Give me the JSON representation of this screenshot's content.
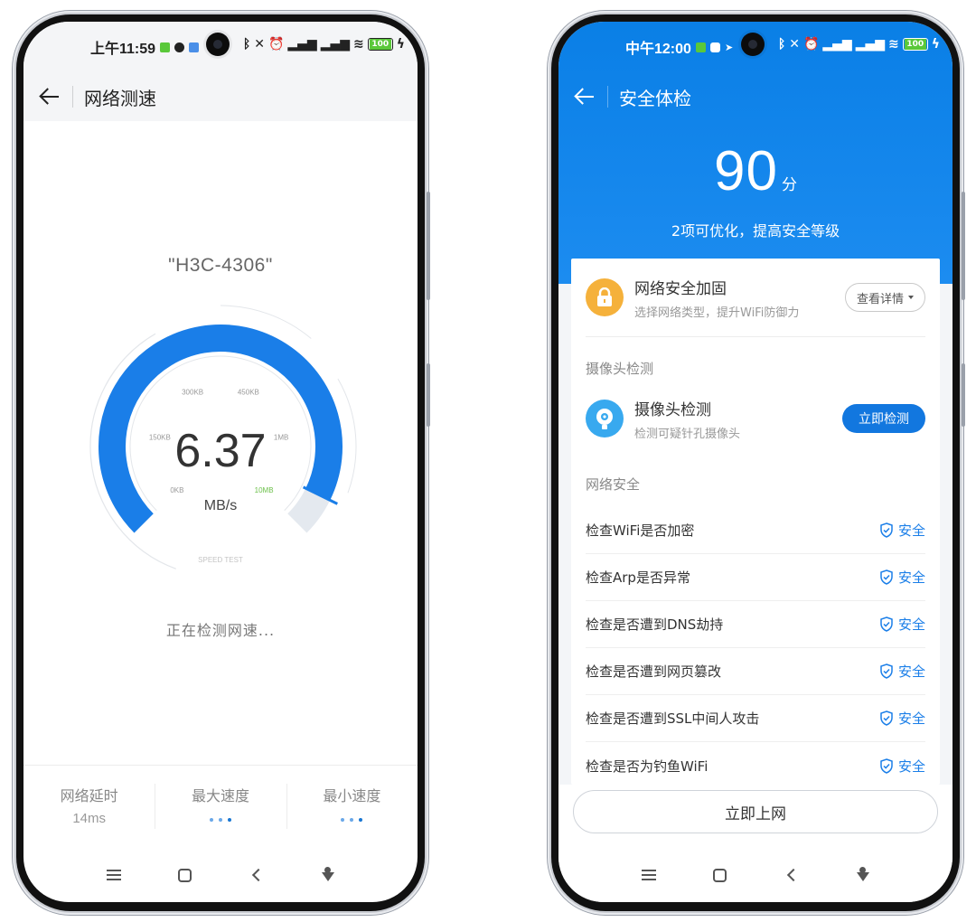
{
  "left_phone": {
    "status_bar": {
      "time": "上午11:59",
      "battery": "100"
    },
    "header": {
      "title": "网络测速"
    },
    "ssid": "\"H3C-4306\"",
    "gauge": {
      "speed_value": "6.37",
      "speed_unit": "MB/s",
      "tick_labels": [
        "0KB",
        "150KB",
        "300KB",
        "450KB",
        "1MB",
        "10MB"
      ],
      "caption": "SPEED TEST",
      "progress_fraction": 0.93,
      "colors": {
        "arc": "#1a7ee8",
        "track": "#e4e9ef",
        "tick_highlight": "#6cc04a"
      }
    },
    "testing_text": "正在检测网速...",
    "stats": [
      {
        "label": "网络延时",
        "value": "14ms"
      },
      {
        "label": "最大速度",
        "value": ""
      },
      {
        "label": "最小速度",
        "value": ""
      }
    ]
  },
  "right_phone": {
    "status_bar": {
      "time": "中午12:00",
      "battery": "100"
    },
    "header": {
      "title": "安全体检"
    },
    "score": {
      "value": "90",
      "unit": "分",
      "subtitle": "2项可优化，提高安全等级"
    },
    "hardening": {
      "title": "网络安全加固",
      "subtitle": "选择网络类型，提升WiFi防御力",
      "button": "查看详情"
    },
    "camera_section": {
      "label": "摄像头检测",
      "title": "摄像头检测",
      "subtitle": "检测可疑针孔摄像头",
      "button": "立即检测"
    },
    "network_section": {
      "label": "网络安全",
      "checks": [
        {
          "label": "检查WiFi是否加密",
          "status": "安全"
        },
        {
          "label": "检查Arp是否异常",
          "status": "安全"
        },
        {
          "label": "检查是否遭到DNS劫持",
          "status": "安全"
        },
        {
          "label": "检查是否遭到网页篡改",
          "status": "安全"
        },
        {
          "label": "检查是否遭到SSL中间人攻击",
          "status": "安全"
        },
        {
          "label": "检查是否为钓鱼WiFi",
          "status": "安全"
        }
      ]
    },
    "go_online_button": "立即上网",
    "colors": {
      "primary": "#1277df",
      "safe": "#1a7ee8",
      "lock_bg": "#f5b13b",
      "camera_bg": "#38a9ef"
    }
  },
  "icons": {
    "back": "back-arrow-icon",
    "nav": [
      "menu-icon",
      "home-icon",
      "back-nav-icon",
      "assistant-icon"
    ]
  }
}
